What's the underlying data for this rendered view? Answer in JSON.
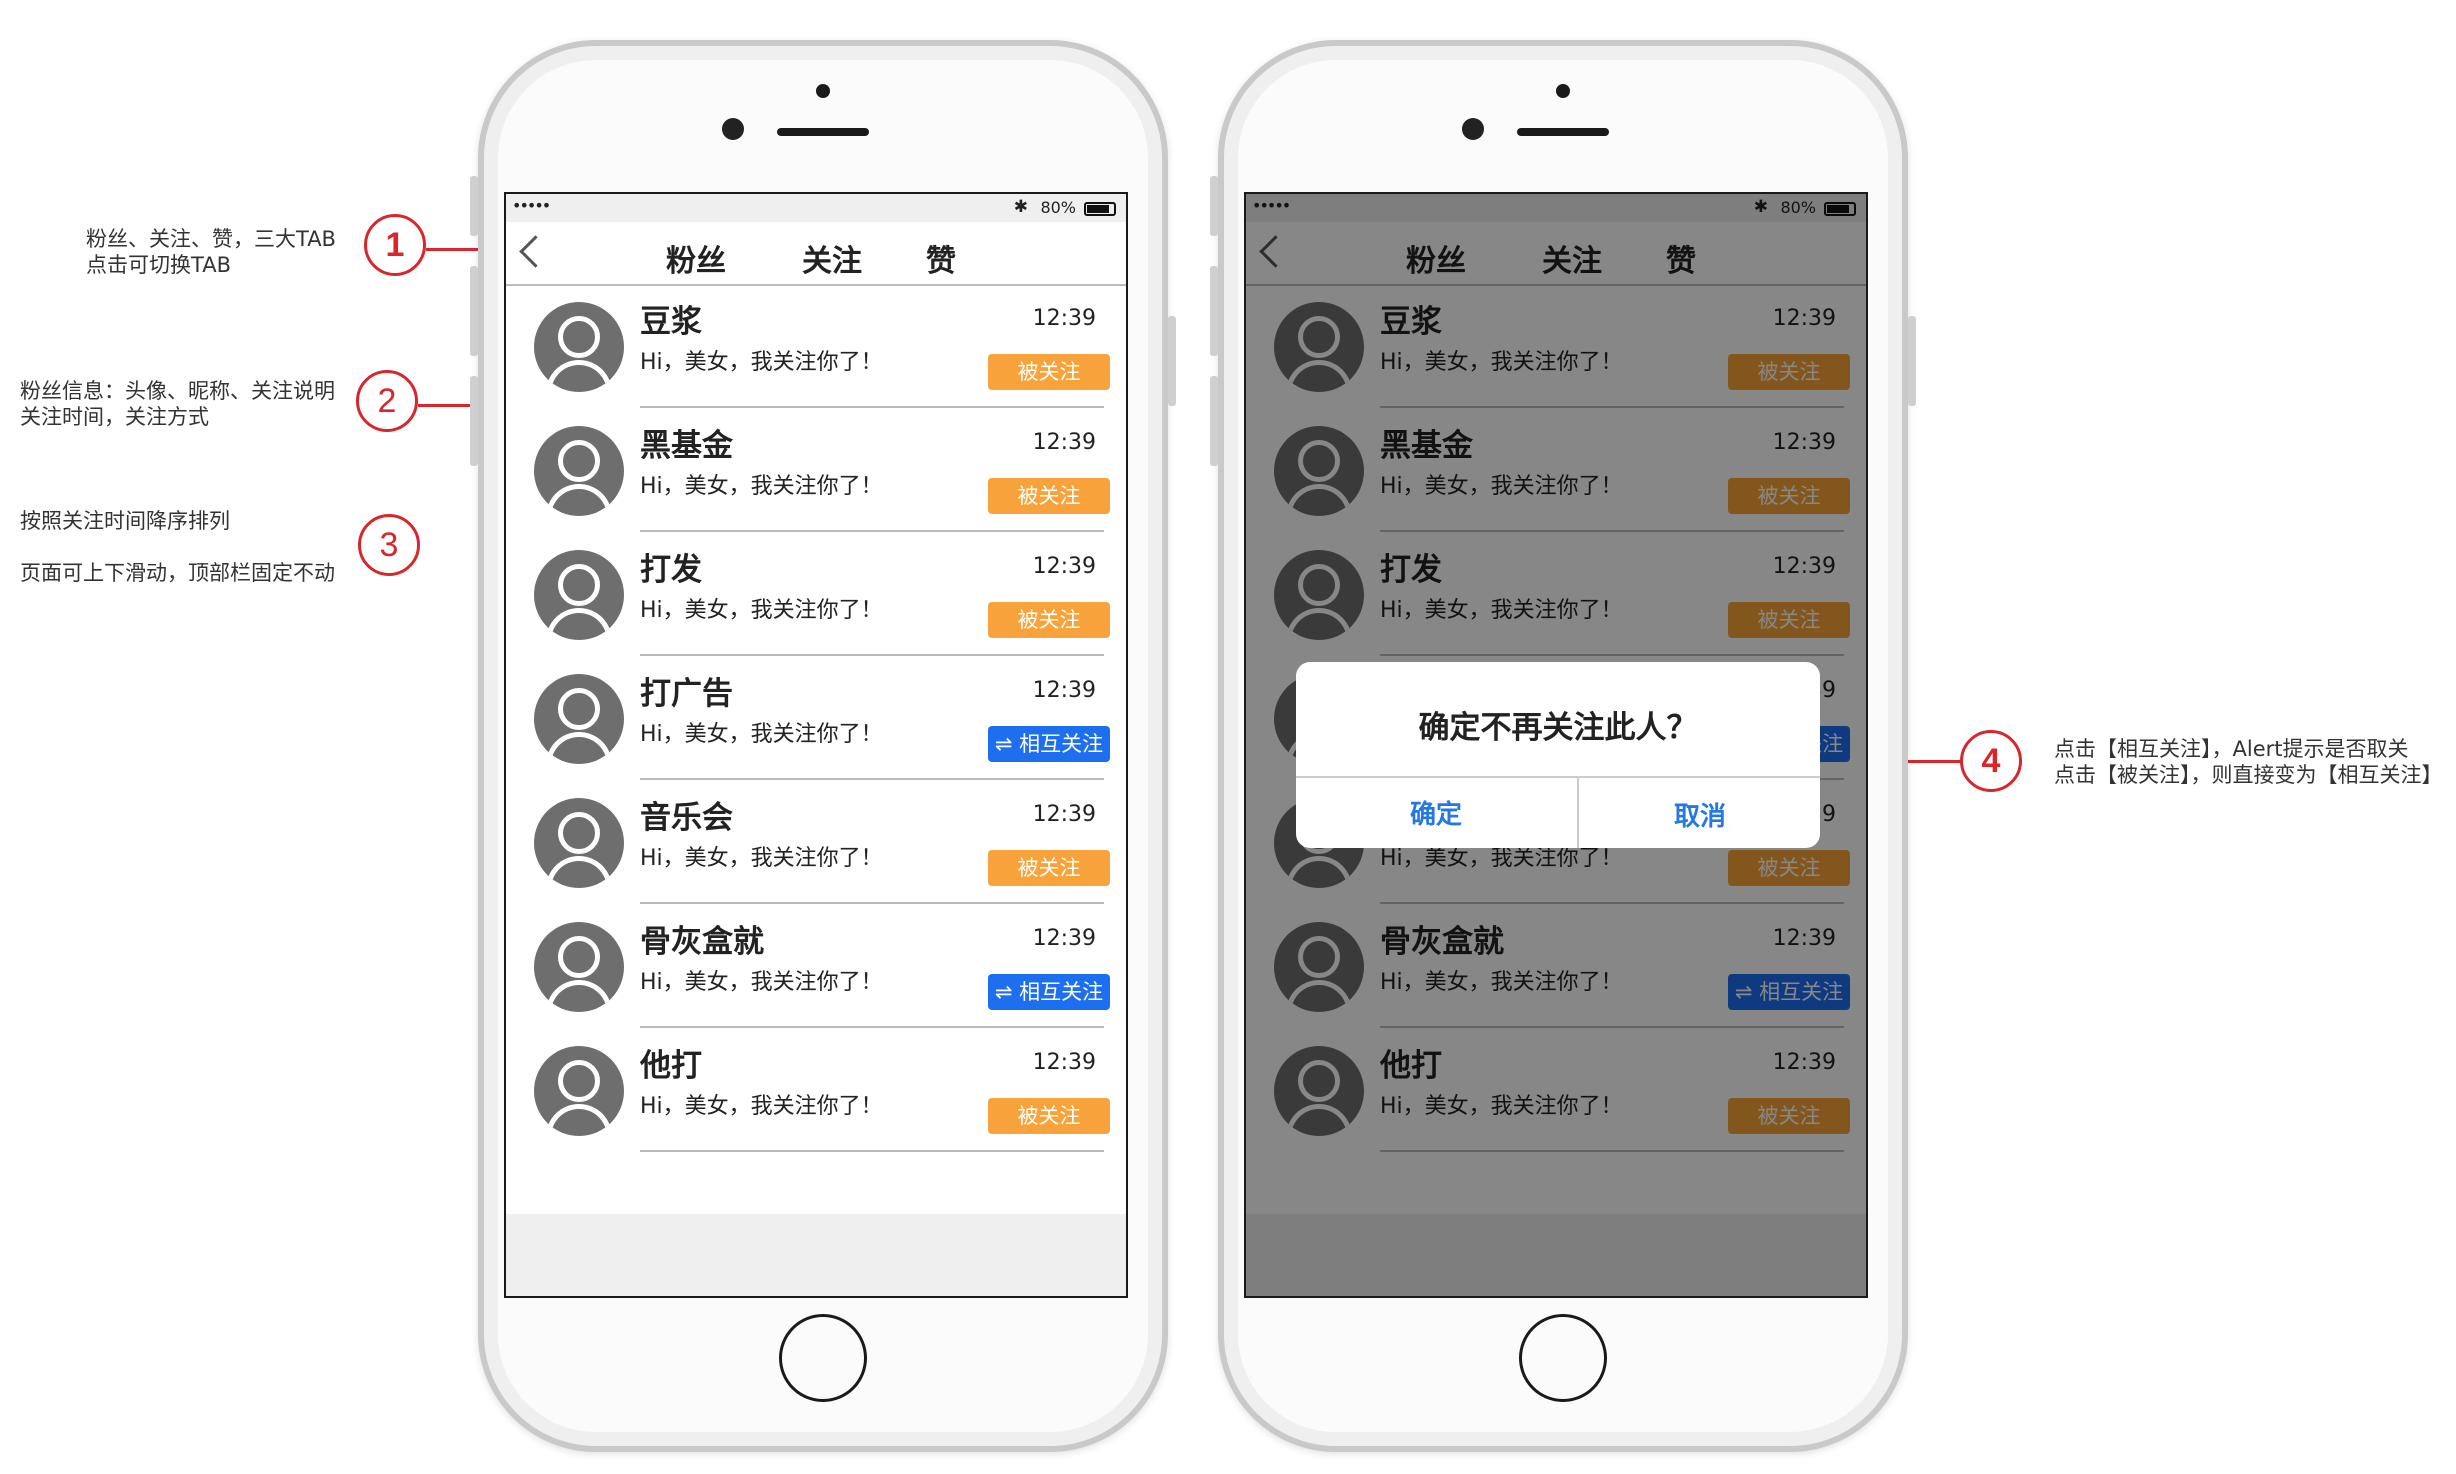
{
  "annotations": {
    "n1": {
      "number": "1",
      "lines": [
        "粉丝、关注、赞，三大TAB",
        "点击可切换TAB"
      ]
    },
    "n2": {
      "number": "2",
      "lines": [
        "粉丝信息：头像、昵称、关注说明",
        "关注时间，关注方式"
      ]
    },
    "n3": {
      "number": "3",
      "lines": [
        "按照关注时间降序排列",
        "页面可上下滑动，顶部栏固定不动"
      ]
    },
    "n4": {
      "number": "4",
      "lines": [
        "点击【相互关注】，Alert提示是否取关",
        "点击【被关注】，则直接变为【相互关注】"
      ]
    }
  },
  "status_bar": {
    "signal": "•••••",
    "bluetooth": "✱",
    "battery": "80%"
  },
  "tabs": [
    "粉丝",
    "关注",
    "赞"
  ],
  "active_tab": "粉丝",
  "rows": [
    {
      "name": "豆浆",
      "message": "Hi，美女，我关注你了！",
      "time": "12:39",
      "button": "被关注",
      "type": "followed"
    },
    {
      "name": "黑基金",
      "message": "Hi，美女，我关注你了！",
      "time": "12:39",
      "button": "被关注",
      "type": "followed"
    },
    {
      "name": "打发",
      "message": "Hi，美女，我关注你了！",
      "time": "12:39",
      "button": "被关注",
      "type": "followed"
    },
    {
      "name": "打广告",
      "message": "Hi，美女，我关注你了！",
      "time": "12:39",
      "button": "⇌ 相互关注",
      "type": "mutual"
    },
    {
      "name": "音乐会",
      "message": "Hi，美女，我关注你了！",
      "time": "12:39",
      "button": "被关注",
      "type": "followed"
    },
    {
      "name": "骨灰盒就",
      "message": "Hi，美女，我关注你了！",
      "time": "12:39",
      "button": "⇌ 相互关注",
      "type": "mutual"
    },
    {
      "name": "他打",
      "message": "Hi，美女，我关注你了！",
      "time": "12:39",
      "button": "被关注",
      "type": "followed"
    }
  ],
  "dialog": {
    "title": "确定不再关注此人？",
    "confirm": "确定",
    "cancel": "取消"
  },
  "colors": {
    "accent": "#2577e3",
    "followed": "#f7a23a",
    "mutual": "#1e6ff0",
    "annotation": "#d8272b"
  }
}
